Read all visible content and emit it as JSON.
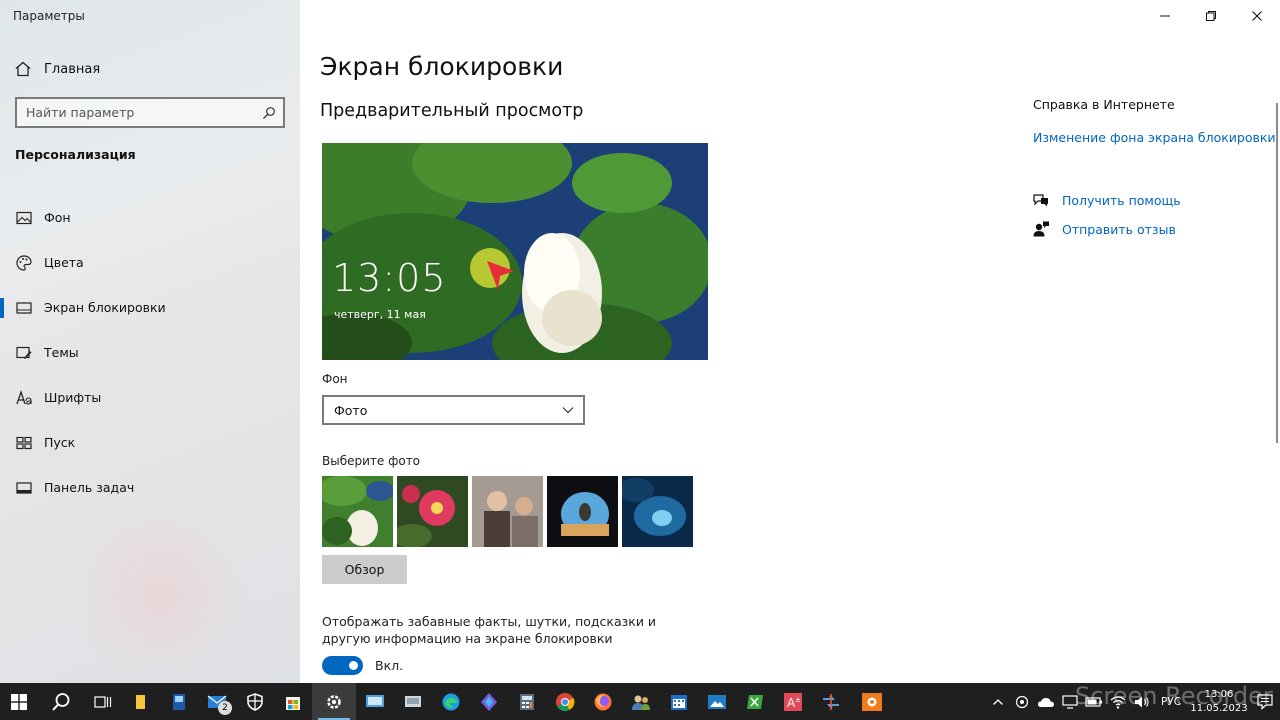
{
  "window": {
    "title": "Параметры"
  },
  "sidebar": {
    "home_label": "Главная",
    "search_placeholder": "Найти параметр",
    "section_title": "Персонализация",
    "items": [
      {
        "label": "Фон",
        "icon": "image-icon"
      },
      {
        "label": "Цвета",
        "icon": "palette-icon"
      },
      {
        "label": "Экран блокировки",
        "icon": "lock-screen-icon",
        "active": true
      },
      {
        "label": "Темы",
        "icon": "themes-icon"
      },
      {
        "label": "Шрифты",
        "icon": "fonts-icon"
      },
      {
        "label": "Пуск",
        "icon": "start-icon"
      },
      {
        "label": "Панель задач",
        "icon": "taskbar-icon"
      }
    ]
  },
  "main": {
    "page_title": "Экран блокировки",
    "preview_title": "Предварительный просмотр",
    "preview_time": "13:05",
    "preview_date": "четверг, 11 мая",
    "background_label": "Фон",
    "background_value": "Фото",
    "choose_photo_label": "Выберите фото",
    "browse_label": "Обзор",
    "facts_label": "Отображать забавные факты, шутки, подсказки и другую информацию на экране блокировки",
    "toggle_label": "Вкл.",
    "toggle_on": true
  },
  "help": {
    "title": "Справка в Интернете",
    "link": "Изменение фона экрана блокировки",
    "get_help": "Получить помощь",
    "feedback": "Отправить отзыв"
  },
  "taskbar": {
    "mail_badge": "2",
    "language": "РУС",
    "time": "13:06",
    "date": "11.05.2023"
  },
  "watermark": "Screen Recorder",
  "colors": {
    "accent": "#0067c0",
    "taskbar": "#1f1f1f"
  }
}
